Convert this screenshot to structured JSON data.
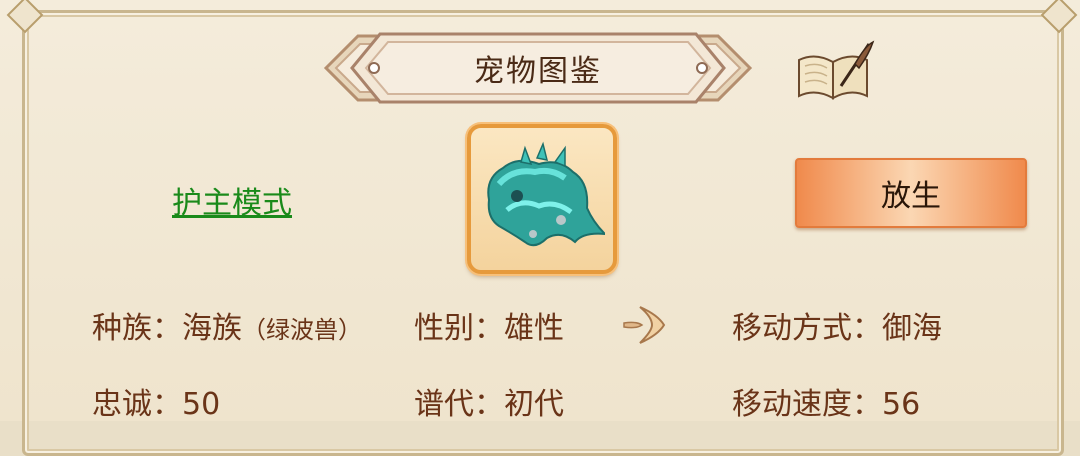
{
  "panel": {
    "title": "宠物图鉴"
  },
  "mode_link": "护主模式",
  "release_button": "放生",
  "stats": {
    "race_label": "种族：",
    "race_value": "海族",
    "race_sub": "（绿波兽）",
    "gender_label": "性别：",
    "gender_value": "雄性",
    "move_mode_label": "移动方式：",
    "move_mode_value": "御海",
    "loyalty_label": "忠诚：",
    "loyalty_value": "50",
    "generation_label": "谱代：",
    "generation_value": "初代",
    "move_speed_label": "移动速度：",
    "move_speed_value": "56"
  },
  "icons": {
    "book": "book-quill-icon",
    "arrow": "arrow-right-icon",
    "pet": "pet-portrait-icon"
  },
  "colors": {
    "title_text": "#4a2a16",
    "link_green": "#1a8a1a",
    "stat_text": "#6a3418",
    "button_orange": "#f08a4c",
    "portrait_border": "#e69a3c"
  }
}
